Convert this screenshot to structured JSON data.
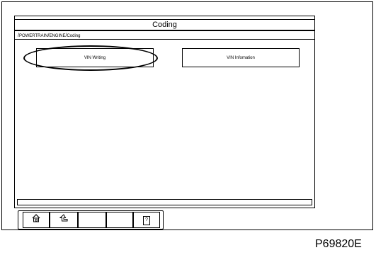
{
  "screen": {
    "title": "Coding",
    "breadcrumb": [
      "POWERTRAIN",
      "ENGINE",
      "Coding"
    ],
    "buttons": {
      "vin_writing": "VIN Writing",
      "vin_information": "VIN Infomation"
    }
  },
  "toolbar": {
    "icons": [
      "home-icon",
      "back-icon",
      "empty",
      "empty",
      "help-icon"
    ],
    "help_label": "?"
  },
  "figure_code": "P69820E"
}
